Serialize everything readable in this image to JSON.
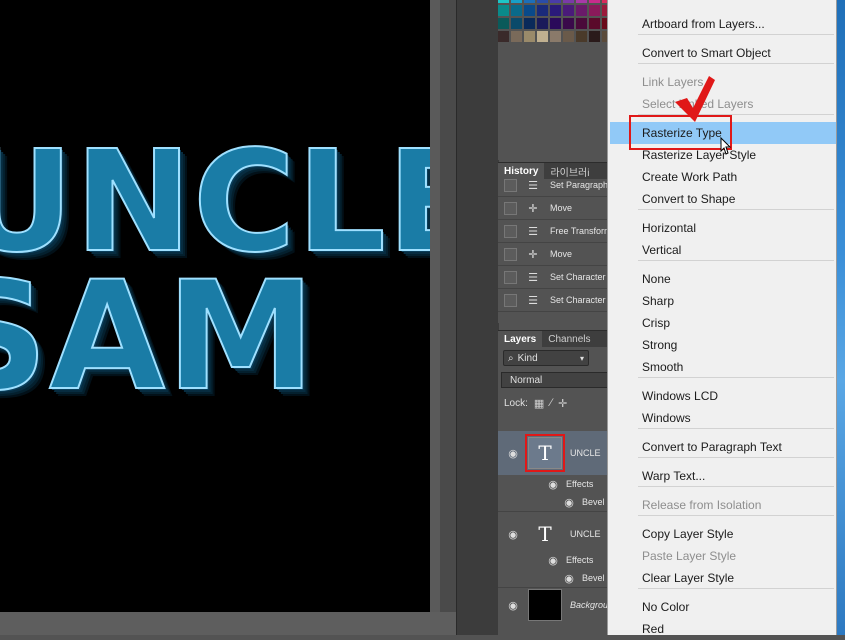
{
  "canvas": {
    "line1": "UNCLE",
    "line2": "SAM"
  },
  "swatches": [
    "#1ec6c6",
    "#18a0c8",
    "#1d6fb8",
    "#2b4da8",
    "#4a3ca8",
    "#7a3aa8",
    "#a83aa8",
    "#c82c8c",
    "#d82c5c",
    "#0a8a8a",
    "#0a6a8a",
    "#0a4a8a",
    "#1a2a7a",
    "#2a1a7a",
    "#4a1a7a",
    "#6a1a6a",
    "#8a1a5a",
    "#9a1a3a",
    "#0a5a5a",
    "#0a4a6a",
    "#0a2a5a",
    "#1a1a5a",
    "#2a0a5a",
    "#3a0a4a",
    "#4a0a3a",
    "#5a0a2a",
    "#6a0a1a",
    "#3a2a2a",
    "#7a6a5a",
    "#9a8a6a",
    "#c0b090",
    "#8a7a6a",
    "#6a5a4a",
    "#4a3a2a",
    "#2a1a1a",
    "#5a4a3a"
  ],
  "history": {
    "tabs": [
      "History",
      "라이브러i"
    ],
    "items": [
      {
        "icon": "document-icon",
        "label": "Set Paragraph"
      },
      {
        "icon": "move-icon",
        "label": "Move"
      },
      {
        "icon": "document-icon",
        "label": "Free Transform"
      },
      {
        "icon": "move-icon",
        "label": "Move"
      },
      {
        "icon": "document-icon",
        "label": "Set Character"
      },
      {
        "icon": "document-icon",
        "label": "Set Character"
      }
    ]
  },
  "layers": {
    "tabs": [
      "Layers",
      "Channels"
    ],
    "kind": "Kind",
    "blend": "Normal",
    "lock": "Lock:",
    "layer1": {
      "name": "UNCLE",
      "effects": "Effects",
      "style": "Bevel"
    },
    "layer2": {
      "name": "UNCLE",
      "effects": "Effects",
      "style": "Bevel"
    },
    "background": {
      "name": "Background"
    }
  },
  "menu": {
    "items": [
      {
        "label": "Artboard from Layers...",
        "state": "normal"
      },
      {
        "label": "Convert to Smart Object",
        "state": "normal"
      },
      {
        "label": "Link Layers",
        "state": "disabled"
      },
      {
        "label": "Select Linked Layers",
        "state": "disabled"
      },
      {
        "label": "Rasterize Type",
        "state": "highlighted"
      },
      {
        "label": "Rasterize Layer Style",
        "state": "normal"
      },
      {
        "label": "Create Work Path",
        "state": "normal"
      },
      {
        "label": "Convert to Shape",
        "state": "normal"
      },
      {
        "label": "Horizontal",
        "state": "normal"
      },
      {
        "label": "Vertical",
        "state": "normal"
      },
      {
        "label": "None",
        "state": "normal"
      },
      {
        "label": "Sharp",
        "state": "normal"
      },
      {
        "label": "Crisp",
        "state": "normal"
      },
      {
        "label": "Strong",
        "state": "normal"
      },
      {
        "label": "Smooth",
        "state": "normal"
      },
      {
        "label": "Windows LCD",
        "state": "normal"
      },
      {
        "label": "Windows",
        "state": "normal"
      },
      {
        "label": "Convert to Paragraph Text",
        "state": "normal"
      },
      {
        "label": "Warp Text...",
        "state": "normal"
      },
      {
        "label": "Release from Isolation",
        "state": "disabled"
      },
      {
        "label": "Copy Layer Style",
        "state": "normal"
      },
      {
        "label": "Paste Layer Style",
        "state": "disabled"
      },
      {
        "label": "Clear Layer Style",
        "state": "normal"
      },
      {
        "label": "No Color",
        "state": "normal"
      },
      {
        "label": "Red",
        "state": "normal"
      }
    ]
  },
  "colors": {
    "highlight": "#91c9f7",
    "annotation": "#e01818"
  }
}
